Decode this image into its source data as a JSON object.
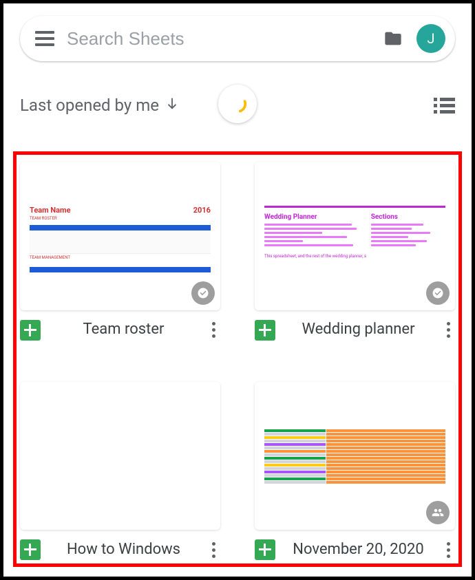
{
  "header": {
    "search_placeholder": "Search Sheets",
    "avatar_initial": "J"
  },
  "sort": {
    "label": "Last opened by me"
  },
  "files": [
    {
      "title": "Team roster",
      "thumb": {
        "kind": "roster",
        "heading": "Team Name",
        "year": "2016",
        "subheading": "TEAM ROSTER",
        "footer": "TEAM MANAGEMENT"
      },
      "offline_badge": true,
      "shared_badge": false
    },
    {
      "title": "Wedding planner",
      "thumb": {
        "kind": "wedding",
        "col1_heading": "Wedding Planner",
        "col2_heading": "Sections",
        "footer_text": "This spreadsheet, and the rest of the wedding planner, s"
      },
      "offline_badge": true,
      "shared_badge": false
    },
    {
      "title": "How to Windows",
      "thumb": {
        "kind": "blank"
      },
      "offline_badge": false,
      "shared_badge": false
    },
    {
      "title": "November 20, 2020",
      "thumb": {
        "kind": "colored-grid"
      },
      "offline_badge": false,
      "shared_badge": true
    }
  ]
}
